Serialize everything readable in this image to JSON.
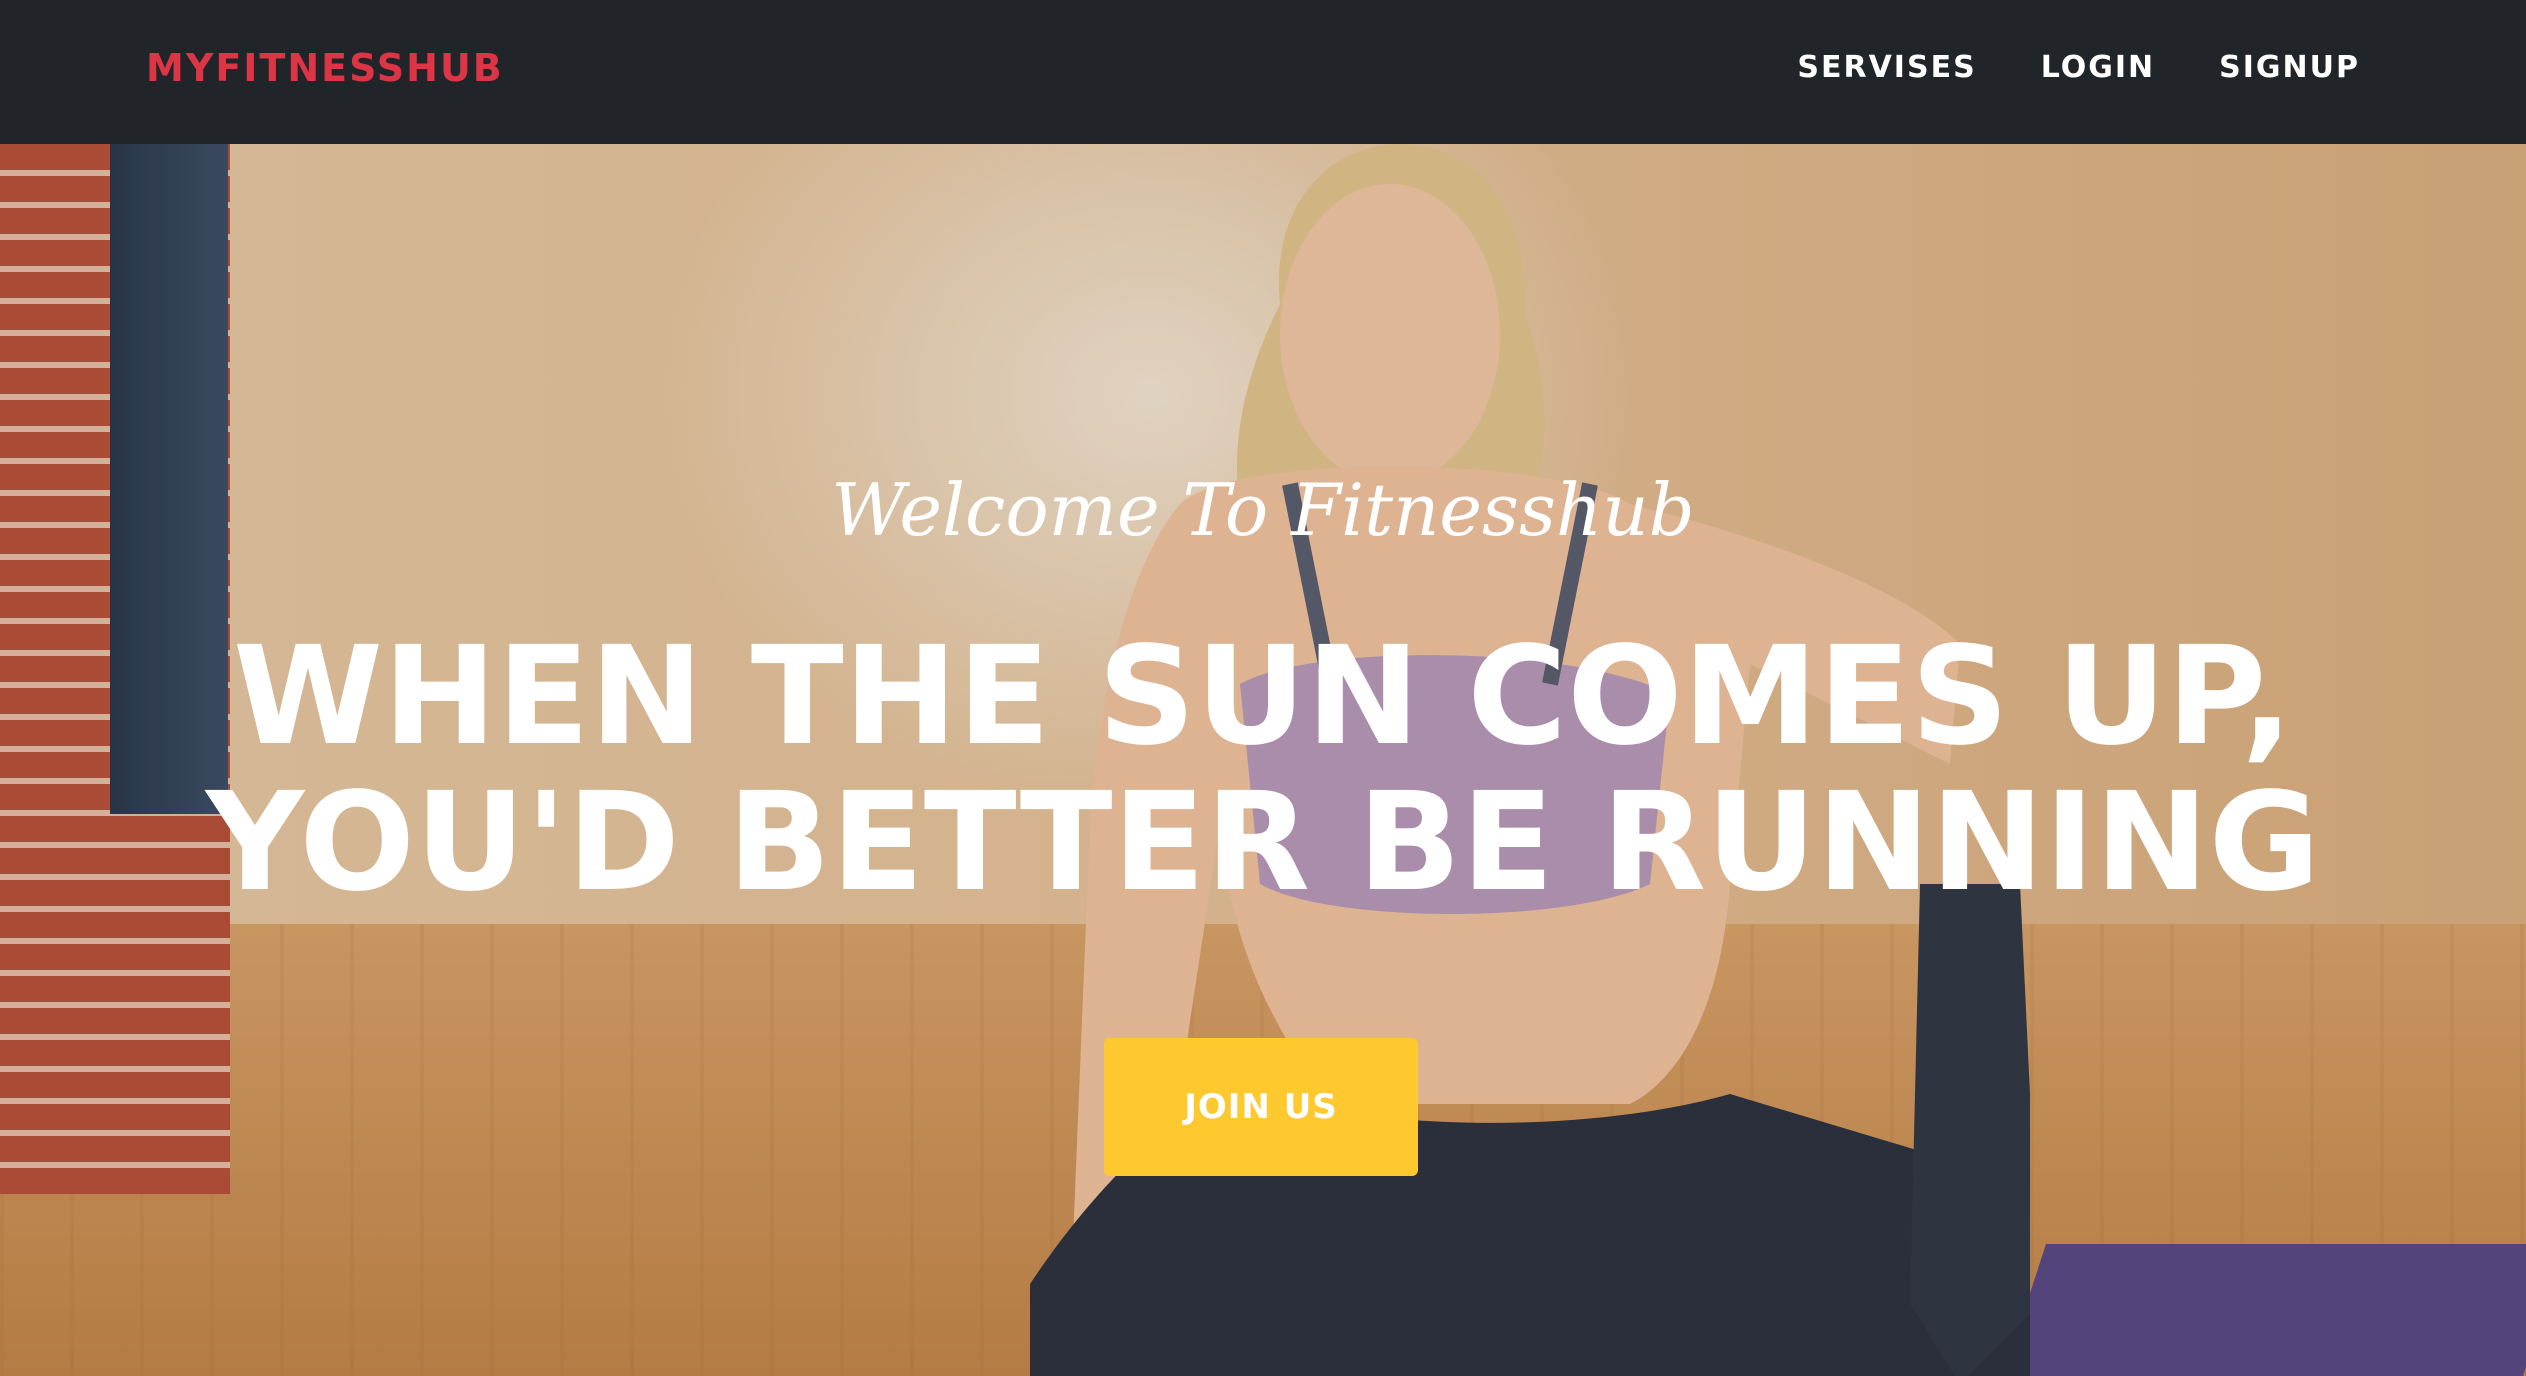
{
  "navbar": {
    "brand": "MYFITNESSHUB",
    "links": [
      {
        "label": "SERVISES"
      },
      {
        "label": "LOGIN"
      },
      {
        "label": "SIGNUP"
      }
    ]
  },
  "hero": {
    "subheading": "Welcome To Fitnesshub",
    "heading_line1": "WHEN THE SUN COMES UP,",
    "heading_line2": "YOU'D BETTER BE RUNNING",
    "cta_label": "JOIN US"
  },
  "colors": {
    "navbar_bg": "#212529",
    "brand": "#dc3545",
    "cta_bg": "#fec82f",
    "text_light": "#ffffff"
  }
}
